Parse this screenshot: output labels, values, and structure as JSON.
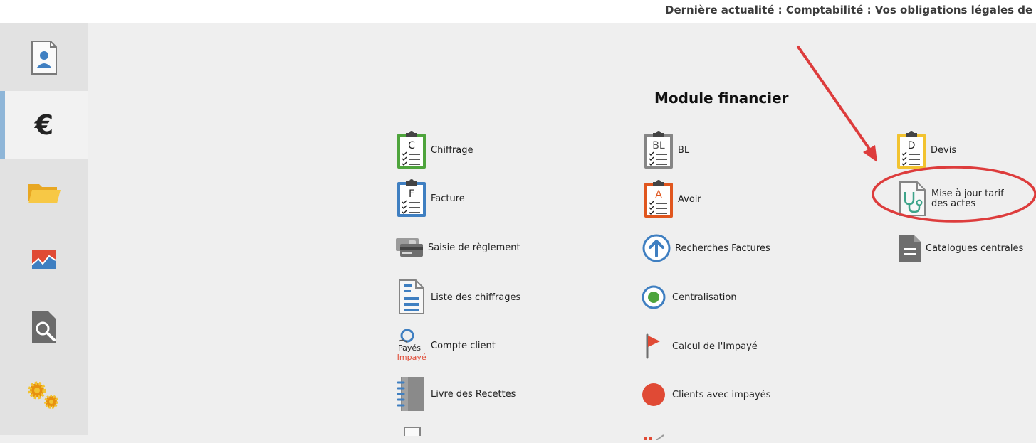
{
  "header": {
    "ticker": "Dernière actualité : Comptabilité : Vos obligations légales de fin d'exercice"
  },
  "sidebar": {
    "items": [
      {
        "icon": "patient-icon"
      },
      {
        "icon": "euro-icon",
        "active": true
      },
      {
        "icon": "folder-icon"
      },
      {
        "icon": "chart-icon"
      },
      {
        "icon": "search-document-icon"
      },
      {
        "icon": "gears-icon"
      }
    ]
  },
  "main": {
    "title": "Module financier",
    "items": {
      "chiffrage": {
        "label": "Chiffrage",
        "icon_letter": "C"
      },
      "facture": {
        "label": "Facture",
        "icon_letter": "F"
      },
      "saisie": {
        "label": "Saisie de règlement"
      },
      "liste": {
        "label": "Liste des chiffrages"
      },
      "compte": {
        "label": "Compte client",
        "icon_text_1": "Payés",
        "icon_text_2": "Impayés"
      },
      "livre": {
        "label": "Livre des Recettes"
      },
      "bl": {
        "label": "BL",
        "icon_letter": "BL"
      },
      "avoir": {
        "label": "Avoir",
        "icon_letter": "A"
      },
      "recherches": {
        "label": "Recherches Factures"
      },
      "centralisation": {
        "label": "Centralisation"
      },
      "calcul": {
        "label": "Calcul de l'Impayé"
      },
      "clients": {
        "label": "Clients avec  impayés"
      },
      "devis": {
        "label": "Devis",
        "icon_letter": "D"
      },
      "maj": {
        "label": "Mise à jour tarif des actes"
      },
      "catalogues": {
        "label": "Catalogues centrales"
      }
    }
  },
  "annotation": {
    "color": "#dd3c3c"
  },
  "colors": {
    "green": "#4ea43c",
    "blue": "#3f7fc1",
    "gray": "#858585",
    "orange": "#e0561e",
    "yellow": "#f2c330",
    "red": "#e04a35"
  }
}
